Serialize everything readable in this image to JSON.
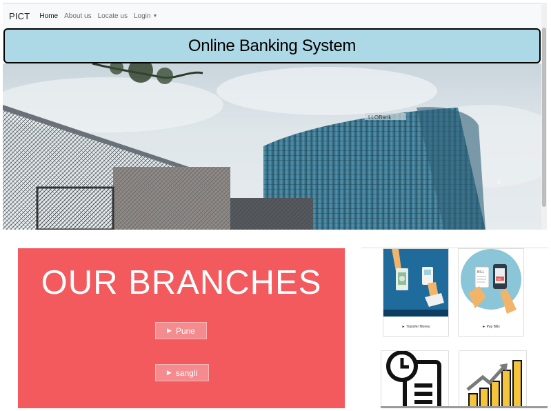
{
  "navbar": {
    "brand": "PICT",
    "links": [
      {
        "label": "Home",
        "active": true
      },
      {
        "label": "About us",
        "active": false
      },
      {
        "label": "Locate us",
        "active": false
      },
      {
        "label": "Login",
        "active": false
      }
    ]
  },
  "header": {
    "title": "Online Banking System"
  },
  "carousel": {
    "prev_icon": "‹",
    "next_icon": "›"
  },
  "branches": {
    "title": "OUR BRANCHES",
    "buttons": [
      {
        "label": "Pune"
      },
      {
        "label": "sangli"
      }
    ]
  },
  "services": [
    {
      "label": "Transfer Money",
      "icon": "money-transfer-illustration"
    },
    {
      "label": "Pay Bills",
      "icon": "pay-bills-illustration"
    },
    {
      "label": "",
      "icon": "clock-document-icon"
    },
    {
      "label": "",
      "icon": "growth-chart-icon"
    }
  ],
  "colors": {
    "header_bg": "#add8e6",
    "branches_bg": "#f25a5e",
    "navbar_bg": "#f8f9fa"
  }
}
